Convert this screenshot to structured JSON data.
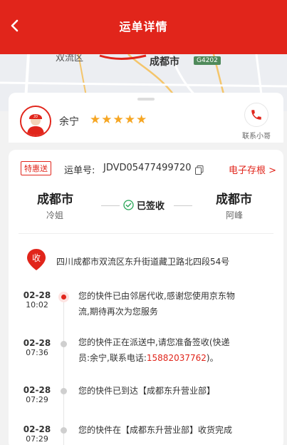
{
  "header": {
    "title": "运单详情"
  },
  "map": {
    "label_district": "双流区",
    "label_city": "成都市",
    "road_shield": "G4202"
  },
  "courier": {
    "name": "余宁",
    "stars": "★★★★★",
    "contact_label": "联系小哥",
    "avatar_text": "JD"
  },
  "waybill": {
    "tag": "特惠送",
    "label": "运单号:",
    "number": "JDVD05477499720",
    "archive": "电子存根 >"
  },
  "route": {
    "from_city": "成都市",
    "from_name": "冷姐",
    "status": "已签收",
    "to_city": "成都市",
    "to_name": "阿峰"
  },
  "address": {
    "pin_label": "收",
    "text": "四川成都市双流区东升街道藏卫路北四段54号"
  },
  "timeline": [
    {
      "date": "02-28",
      "time": "10:02",
      "text_line1": "您的快件已由邻居代收,感谢您使用京东物",
      "text_line2": "流,期待再次为您服务"
    },
    {
      "date": "02-28",
      "time": "07:36",
      "text_line1": "您的快件正在派送中,请您准备签收(快递",
      "text_line2a": "员:余宁,联系电话:",
      "phone": "15882037762",
      "text_line2b": ")。"
    },
    {
      "date": "02-28",
      "time": "07:29",
      "text_line1": "您的快件已到达【成都东升营业部】"
    },
    {
      "date": "02-28",
      "time": "07:29",
      "text_line1": "您的快件在【成都东升营业部】收货完成"
    }
  ],
  "colors": {
    "brand": "#e1251b",
    "star": "#f6a623"
  }
}
